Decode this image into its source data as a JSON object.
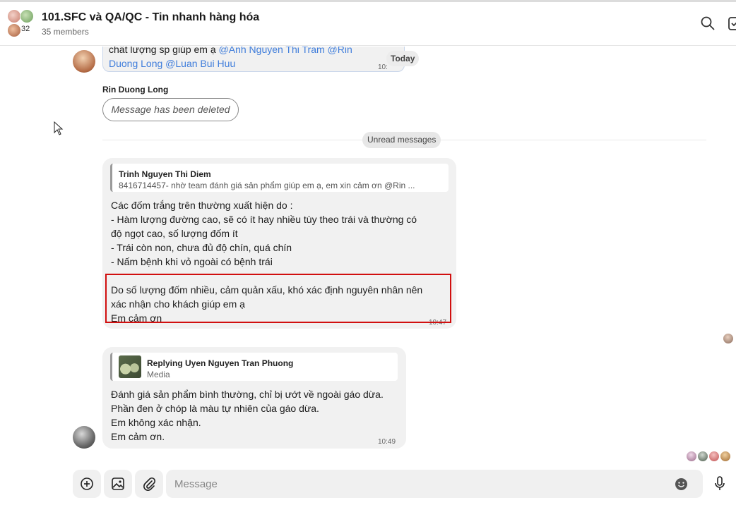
{
  "header": {
    "title": "101.SFC và QA/QC - Tin nhanh hàng hóa",
    "members": "35 members",
    "avatar_count": "32",
    "icons": [
      "search-icon",
      "calendar-icon"
    ]
  },
  "chat": {
    "prev_message": {
      "line1": "chất lượng sp giúp em ạ ",
      "mention1": "@Anh Nguyen Thi Tram",
      "mention2": " @Rin",
      "line2_mention1": "Duong Long",
      "line2_mention2": " @Luan Bui Huu",
      "time": "10:"
    },
    "today_label": "Today",
    "deleted_message": {
      "sender": "Rin Duong Long",
      "text": "Message has been deleted"
    },
    "unread_label": "Unread messages",
    "message1": {
      "quote_name": "Trinh Nguyen Thi Diem",
      "quote_text": "8416714457- nhờ team đánh giá sản phẩm giúp em ạ, em xin cảm ơn @Rin ...",
      "lines": [
        "Các đốm trắng trên thường xuất hiện do :",
        "- Hàm lượng đường cao, sẽ có ít hay nhiều tùy theo trái và thường có",
        "độ ngọt cao, số lượng đốm ít",
        "- Trái còn non, chưa đủ độ chín, quá chín",
        "- Nấm bệnh khi vỏ ngoài có bệnh trái",
        "Do số lượng đốm nhiều, cảm quản xấu, khó xác định nguyên nhân nên",
        "xác nhận cho khách giúp em ạ",
        "Em cảm ơn"
      ],
      "time": "10:47"
    },
    "message2": {
      "reply_label": "Replying Uyen Nguyen Tran Phuong",
      "reply_type": "Media",
      "lines": [
        "Đánh giá sản phẩm bình thường, chỉ bị ướt về ngoài gáo dừa.",
        "Phần đen ở chóp là màu tự nhiên của gáo dừa.",
        "Em không xác nhận.",
        "Em cảm ơn."
      ],
      "time": "10:49"
    }
  },
  "composer": {
    "placeholder": "Message",
    "buttons": [
      "plus-icon",
      "image-icon",
      "paperclip-icon"
    ],
    "emoji_icon": "emoji-icon",
    "mic_icon": "mic-icon"
  },
  "colors": {
    "mention": "#3f7ddb",
    "bubble": "#f1f1f1",
    "highlight": "#d10f0f"
  }
}
